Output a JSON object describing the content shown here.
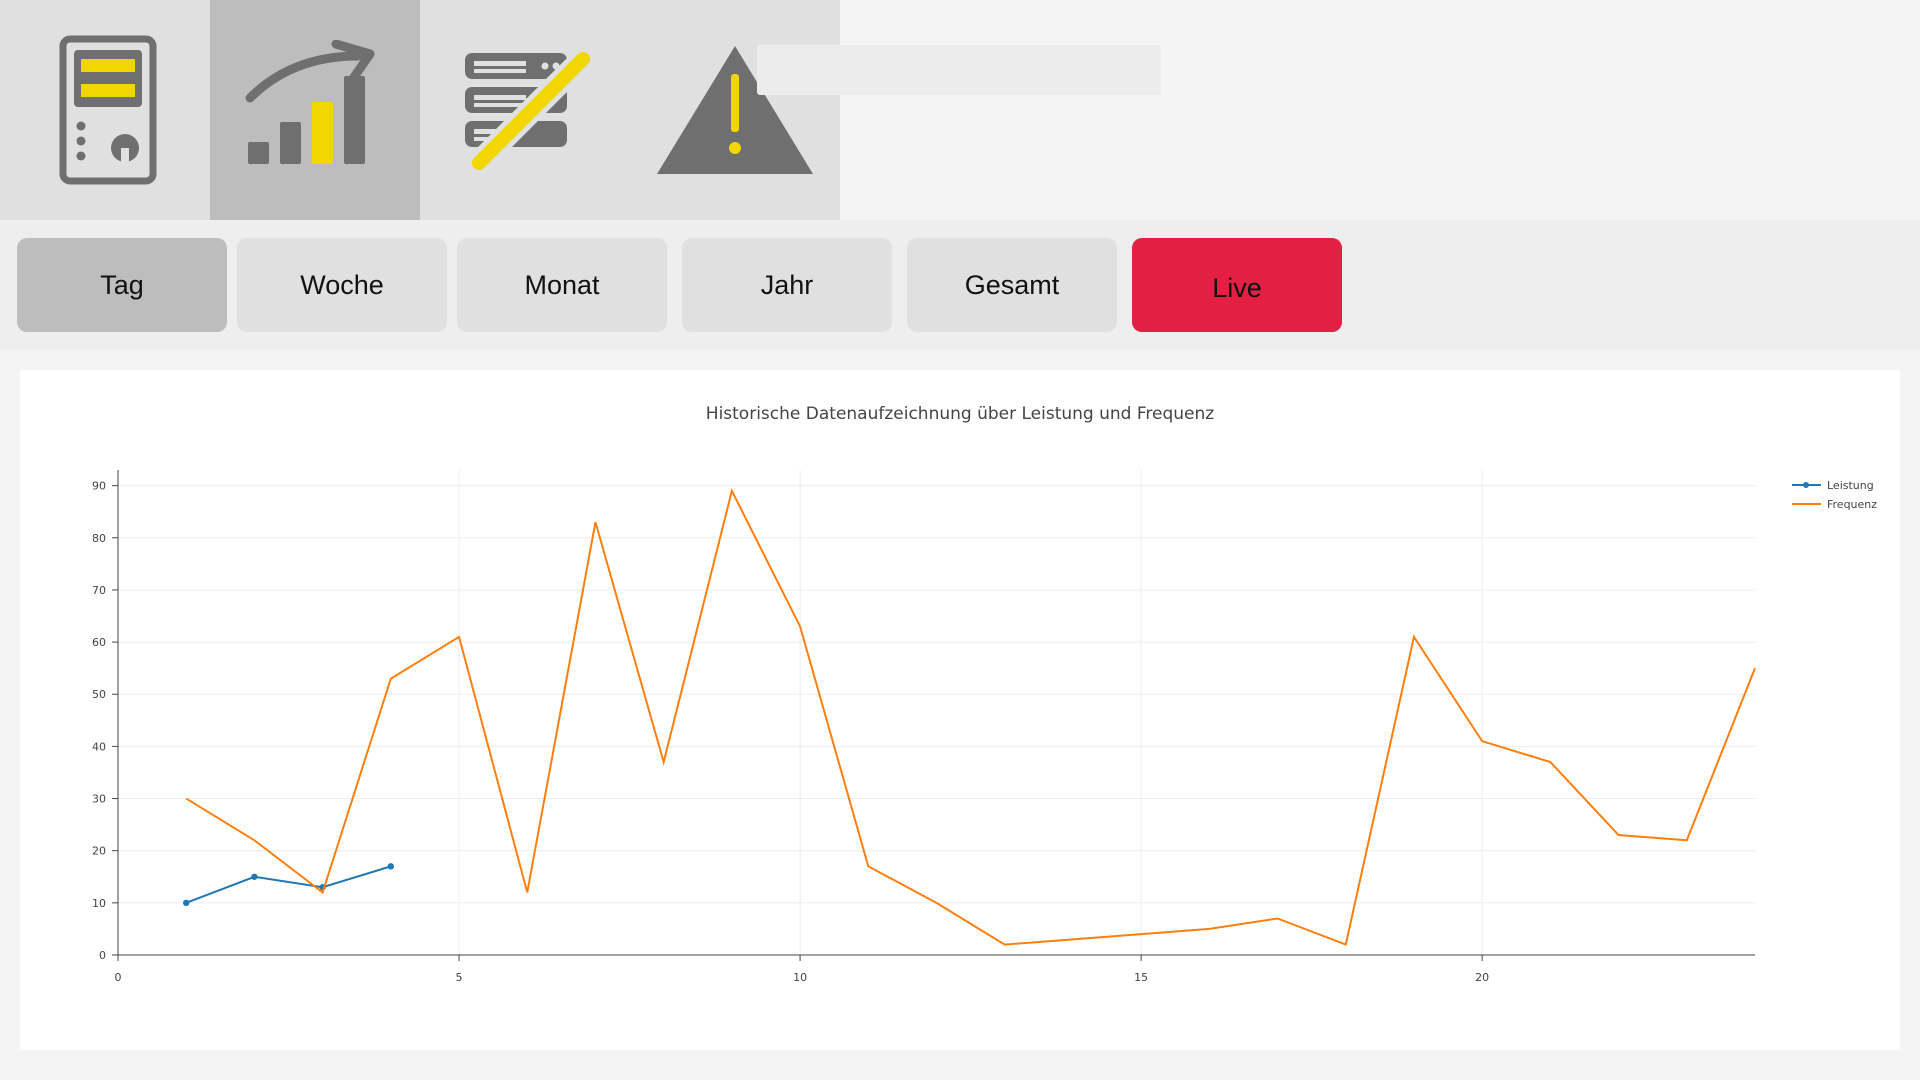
{
  "colors": {
    "accent": "#f1d600",
    "icon_gray": "#6f6f6f",
    "live_red": "#e32043",
    "leistung": "#1f77b4",
    "frequenz": "#ff7f0e"
  },
  "nav": {
    "items": [
      {
        "icon": "server-status-icon",
        "active": false
      },
      {
        "icon": "statistics-chart-icon",
        "active": true
      },
      {
        "icon": "server-edit-icon",
        "active": false
      },
      {
        "icon": "warning-icon",
        "active": false
      }
    ]
  },
  "tabs": {
    "day": "Tag",
    "week": "Woche",
    "month": "Monat",
    "year": "Jahr",
    "total": "Gesamt",
    "live": "Live"
  },
  "chart_data": {
    "type": "line",
    "title": "Historische Datenaufzeichnung über Leistung und Frequenz",
    "xlabel": "",
    "ylabel": "",
    "xlim": [
      0,
      24
    ],
    "ylim": [
      0,
      93
    ],
    "xticks": [
      0,
      5,
      10,
      15,
      20
    ],
    "yticks": [
      0,
      10,
      20,
      30,
      40,
      50,
      60,
      70,
      80,
      90
    ],
    "grid": true,
    "legend_position": "top-right",
    "series": [
      {
        "name": "Leistung",
        "color": "#1f77b4",
        "markers": true,
        "x": [
          1,
          2,
          3,
          4
        ],
        "y": [
          10,
          15,
          13,
          17
        ]
      },
      {
        "name": "Frequenz",
        "color": "#ff7f0e",
        "markers": false,
        "x": [
          1,
          2,
          3,
          4,
          5,
          6,
          7,
          8,
          9,
          10,
          11,
          12,
          13,
          14,
          15,
          16,
          17,
          18,
          19,
          20,
          21,
          22,
          23,
          24
        ],
        "y": [
          30,
          22,
          12,
          53,
          61,
          12,
          83,
          37,
          89,
          63,
          17,
          10,
          2,
          3,
          4,
          5,
          7,
          2,
          61,
          41,
          37,
          23,
          22,
          55
        ]
      }
    ]
  }
}
